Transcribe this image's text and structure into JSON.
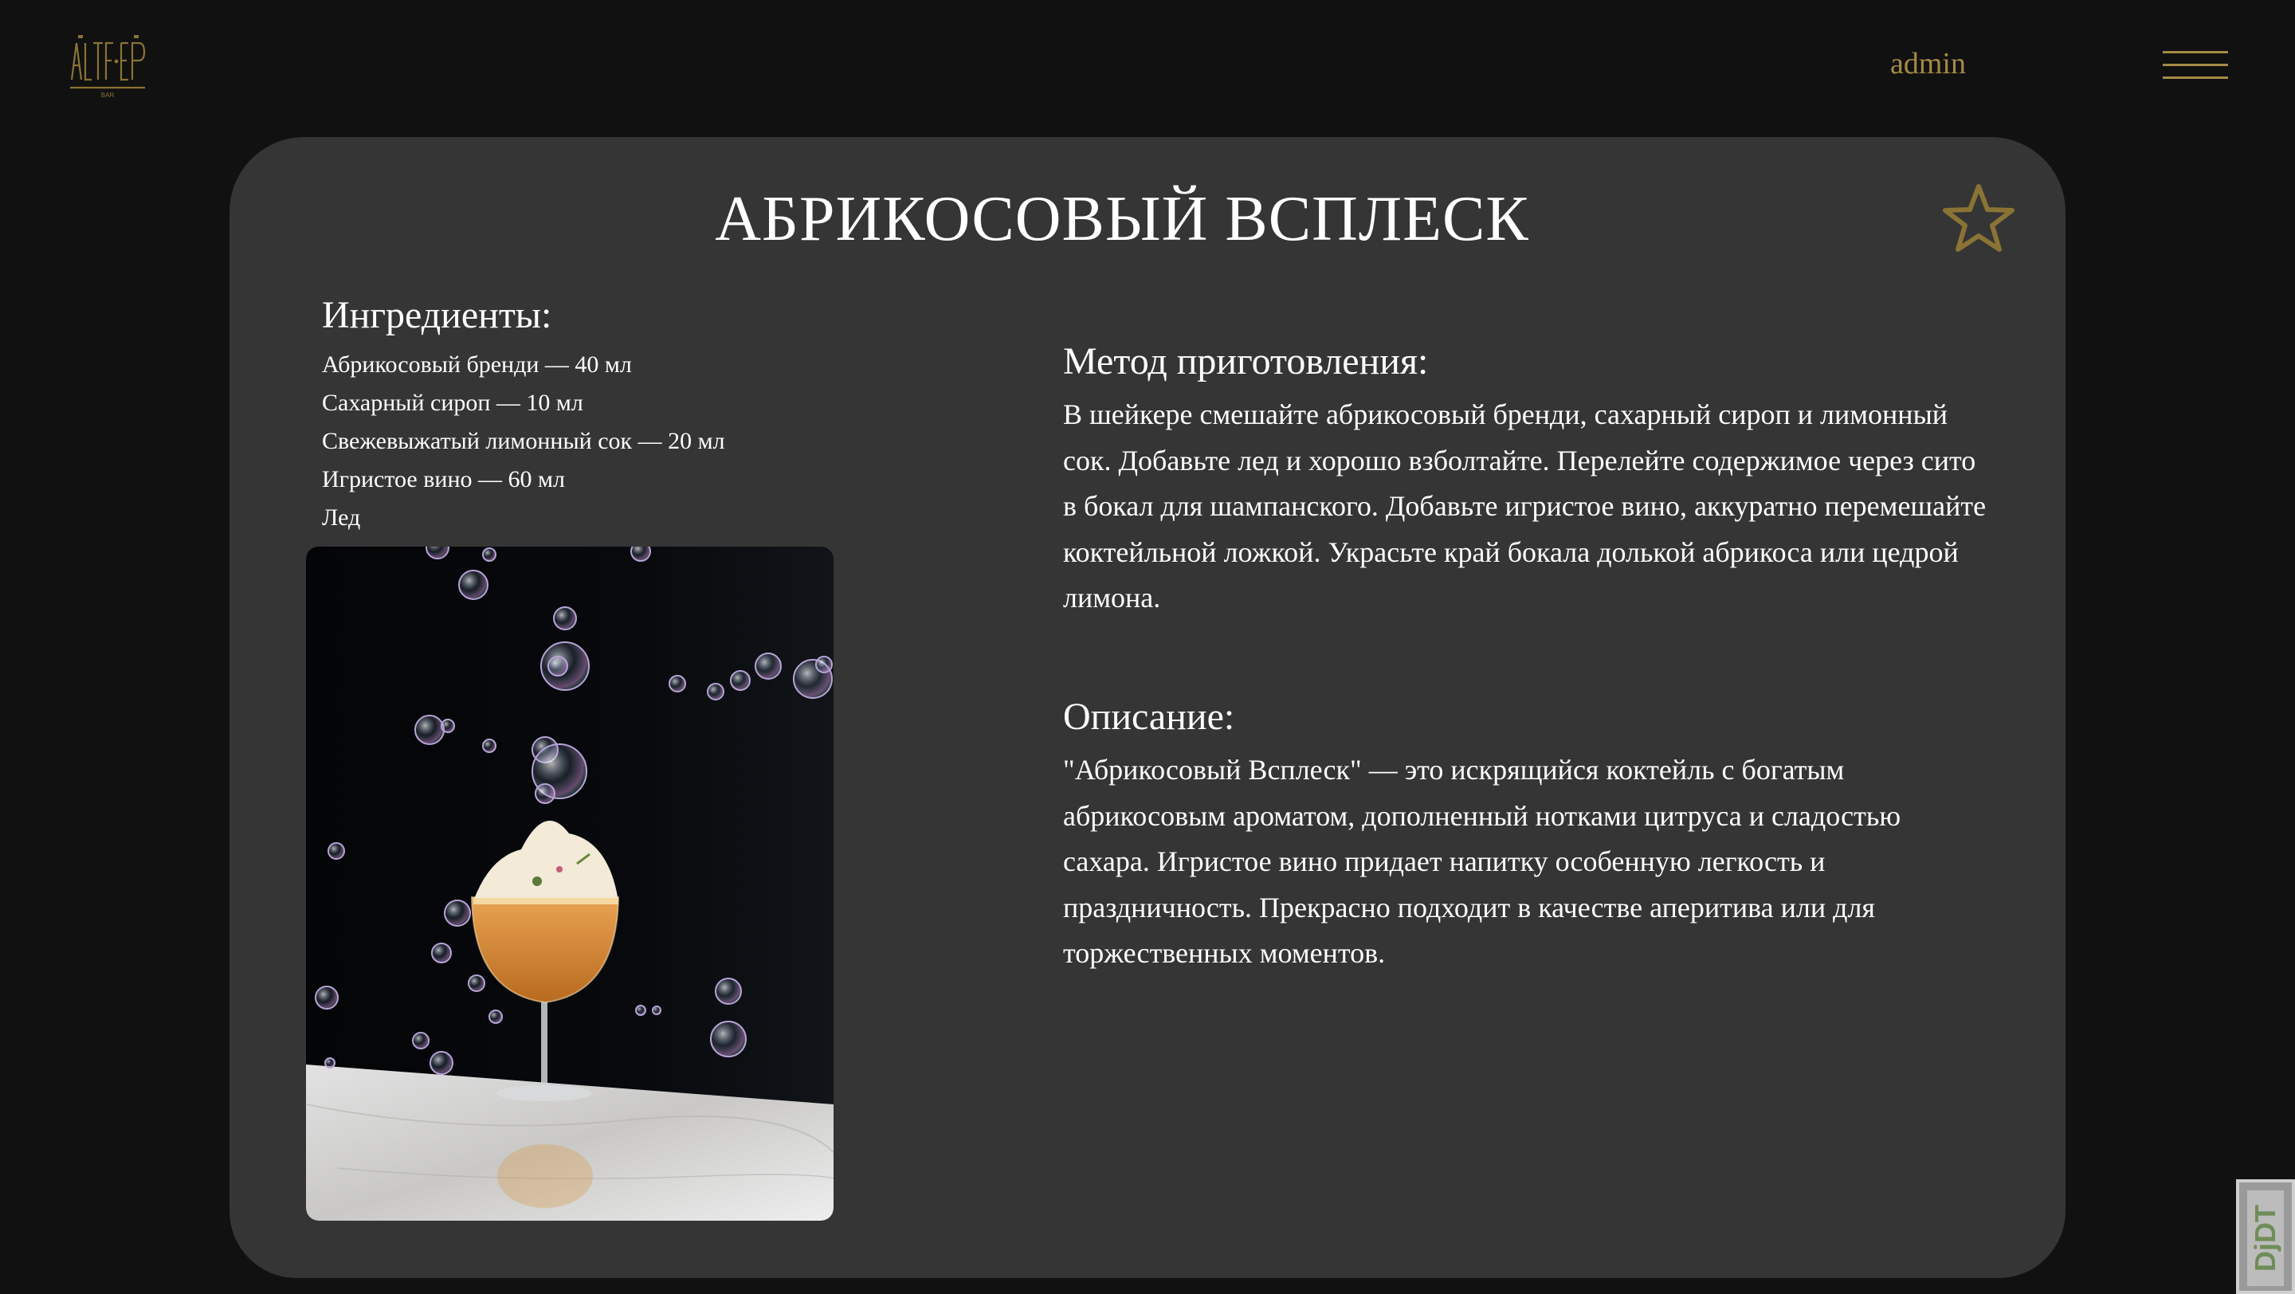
{
  "header": {
    "logo_text": "ALTF·EP",
    "logo_subtext": "BAR",
    "user_label": "admin",
    "menu_icon": "hamburger-menu-icon"
  },
  "cocktail": {
    "title": "АБРИКОСОВЫЙ ВСПЛЕСК",
    "favorite_icon": "star-outline-icon",
    "ingredients_title": "Ингредиенты:",
    "ingredients": [
      "Абрикосовый бренди — 40 мл",
      "Сахарный сироп — 10 мл",
      "Свежевыжатый лимонный сок — 20 мл",
      "Игристое вино — 60 мл",
      "Лед"
    ],
    "method_title": "Метод приготовления:",
    "method_text": "В шейкере смешайте абрикосовый бренди, сахарный сироп и лимонный сок. Добавьте лед и хорошо взболтайте. Перелейте содержимое через сито в бокал для шампанского. Добавьте игристое вино, аккуратно перемешайте коктейльной ложкой. Украсьте край бокала долькой абрикоса или цедрой лимона.",
    "description_title": "Описание:",
    "description_text": "\"Абрикосовый Всплеск\" — это искрящийся коктейль с богатым абрикосовым ароматом, дополненный нотками цитруса и сладостью сахара. Игристое вино придает напитку особенную легкость и праздничность. Прекрасно подходит в качестве аперитива или для торжественных моментов."
  },
  "debug_toolbar": {
    "label": "DjDT"
  },
  "colors": {
    "background": "#111111",
    "card": "#353535",
    "accent_gold": "#a38a45",
    "text": "#ffffff"
  }
}
